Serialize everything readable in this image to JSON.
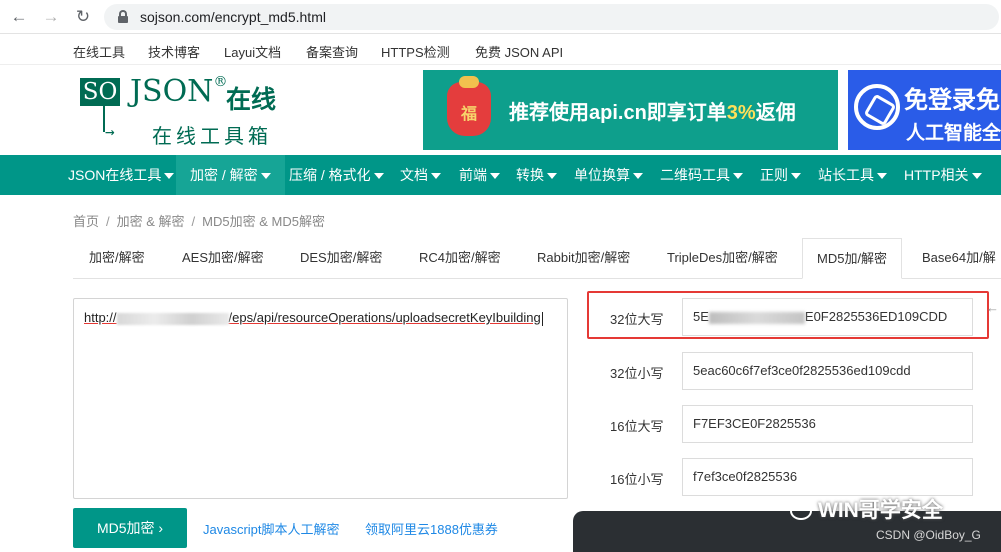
{
  "browser": {
    "url": "sojson.com/encrypt_md5.html"
  },
  "top_links": [
    "在线工具",
    "技术博客",
    "Layui文档",
    "备案查询",
    "HTTPS检测",
    "免费 JSON API"
  ],
  "logo": {
    "mark": "SO",
    "name": "JSON",
    "reg": "®",
    "suffix": "在线",
    "tagline": "在线工具箱"
  },
  "banners": {
    "left": {
      "fu": "福",
      "text_a": "推荐使用api.cn即享订单",
      "text_hl": "3%",
      "text_b": "返佣"
    },
    "right": {
      "line1": "免登录免",
      "line2": "人工智能全"
    }
  },
  "main_nav": [
    {
      "label": "JSON在线工具"
    },
    {
      "label": "加密 / 解密",
      "active": true
    },
    {
      "label": "压缩 / 格式化"
    },
    {
      "label": "文档"
    },
    {
      "label": "前端"
    },
    {
      "label": "转换"
    },
    {
      "label": "单位换算"
    },
    {
      "label": "二维码工具"
    },
    {
      "label": "正则"
    },
    {
      "label": "站长工具"
    },
    {
      "label": "HTTP相关"
    }
  ],
  "breadcrumb": [
    "首页",
    "加密 & 解密",
    "MD5加密 & MD5解密"
  ],
  "tabs": [
    "加密/解密",
    "AES加密/解密",
    "DES加密/解密",
    "RC4加密/解密",
    "Rabbit加密/解密",
    "TripleDes加密/解密",
    "MD5加/解密",
    "Base64加/解"
  ],
  "input": {
    "text_prefix": "http://",
    "text_suffix": "/eps/api/resourceOperations/uploadsecretKeyIbuilding"
  },
  "actions": {
    "md5_button": "MD5加密",
    "link_manual": "Javascript脚本人工解密",
    "link_coupon": "领取阿里云1888优惠券"
  },
  "results": {
    "upper32": {
      "label": "32位大写",
      "value_prefix": "5E",
      "value_suffix": "E0F2825536ED109CDD"
    },
    "lower32": {
      "label": "32位小写",
      "value": "5eac60c6f7ef3ce0f2825536ed109cdd"
    },
    "upper16": {
      "label": "16位大写",
      "value": "F7EF3CE0F2825536"
    },
    "lower16": {
      "label": "16位小写",
      "value": "f7ef3ce0f2825536"
    }
  },
  "watermark": {
    "text": "WIN哥学安全",
    "credit": "CSDN @OidBoy_G"
  },
  "colors": {
    "brand_green": "#009688",
    "highlight_red": "#e53935",
    "link_blue": "#1e88e5"
  }
}
